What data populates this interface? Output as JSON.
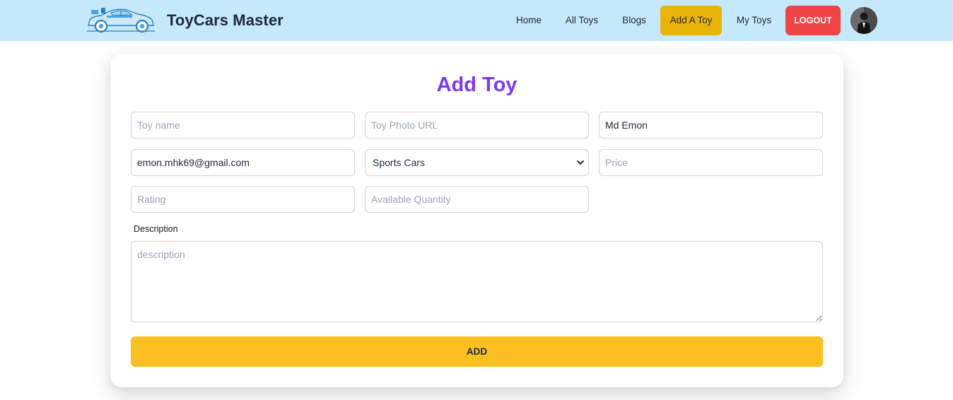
{
  "header": {
    "brand": "ToyCars Master",
    "logo_icon": "toy-car-logo-icon",
    "nav": [
      {
        "label": "Home"
      },
      {
        "label": "All Toys"
      },
      {
        "label": "Blogs"
      },
      {
        "label": "Add A Toy",
        "active": true
      },
      {
        "label": "My Toys"
      }
    ],
    "logout_label": "LOGOUT",
    "avatar_icon": "user-avatar",
    "active_color": "#eab308",
    "logout_color": "#ef4444",
    "bg_color": "#c5e8fa"
  },
  "form": {
    "title": "Add Toy",
    "title_color": "#7c3aed",
    "toy_name": {
      "placeholder": "Toy name",
      "value": ""
    },
    "photo_url": {
      "placeholder": "Toy Photo URL",
      "value": ""
    },
    "seller_name": {
      "value": "Md Emon"
    },
    "seller_email": {
      "value": "emon.mhk69@gmail.com"
    },
    "category": {
      "selected": "Sports Cars"
    },
    "price": {
      "placeholder": "Price",
      "value": ""
    },
    "rating": {
      "placeholder": "Rating",
      "value": ""
    },
    "quantity": {
      "placeholder": "Available Quantity",
      "value": ""
    },
    "description_label": "Description",
    "description": {
      "placeholder": "description",
      "value": ""
    },
    "submit_label": "ADD",
    "submit_color": "#fbbf24"
  }
}
